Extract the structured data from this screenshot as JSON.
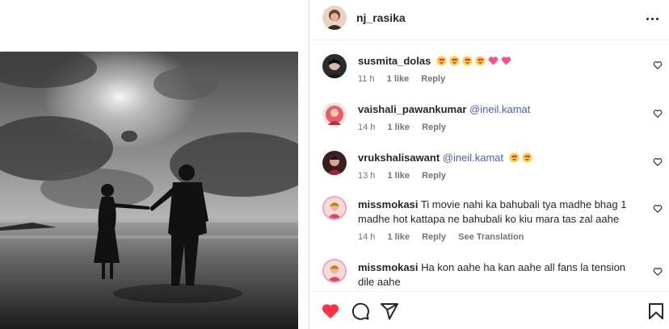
{
  "post": {
    "username": "nj_rasika"
  },
  "comments": [
    {
      "username": "susmita_dolas",
      "mention": "",
      "text": "",
      "emojis": [
        "heart-eyes",
        "heart-eyes",
        "heart-eyes",
        "heart-eyes",
        "pink-heart",
        "pink-heart"
      ],
      "time": "11 h",
      "likes": "1 like",
      "reply": "Reply",
      "translate": ""
    },
    {
      "username": "vaishali_pawankumar",
      "mention": "@ineil.kamat",
      "text": "",
      "emojis": [],
      "time": "14 h",
      "likes": "1 like",
      "reply": "Reply",
      "translate": ""
    },
    {
      "username": "vrukshalisawant",
      "mention": "@ineil.kamat",
      "text": "",
      "emojis": [
        "heart-eyes",
        "heart-eyes"
      ],
      "time": "13 h",
      "likes": "1 like",
      "reply": "Reply",
      "translate": ""
    },
    {
      "username": "missmokasi",
      "mention": "",
      "text": "Ti movie nahi ka bahubali tya madhe bhag 1 madhe hot kattapa ne bahubali ko kiu mara tas zal aahe",
      "emojis": [],
      "time": "14 h",
      "likes": "1 like",
      "reply": "Reply",
      "translate": "See Translation"
    },
    {
      "username": "missmokasi",
      "mention": "",
      "text": "Ha kon aahe ha kan aahe all fans la tension dile aahe",
      "emojis": [],
      "time": "",
      "likes": "",
      "reply": "",
      "translate": ""
    }
  ],
  "colors": {
    "like_red": "#ff3040",
    "mention_blue": "#4a5eb5",
    "meta_gray": "#737373"
  },
  "icons": [
    "more-options-icon",
    "heart-icon",
    "comment-icon",
    "share-icon",
    "bookmark-icon"
  ]
}
